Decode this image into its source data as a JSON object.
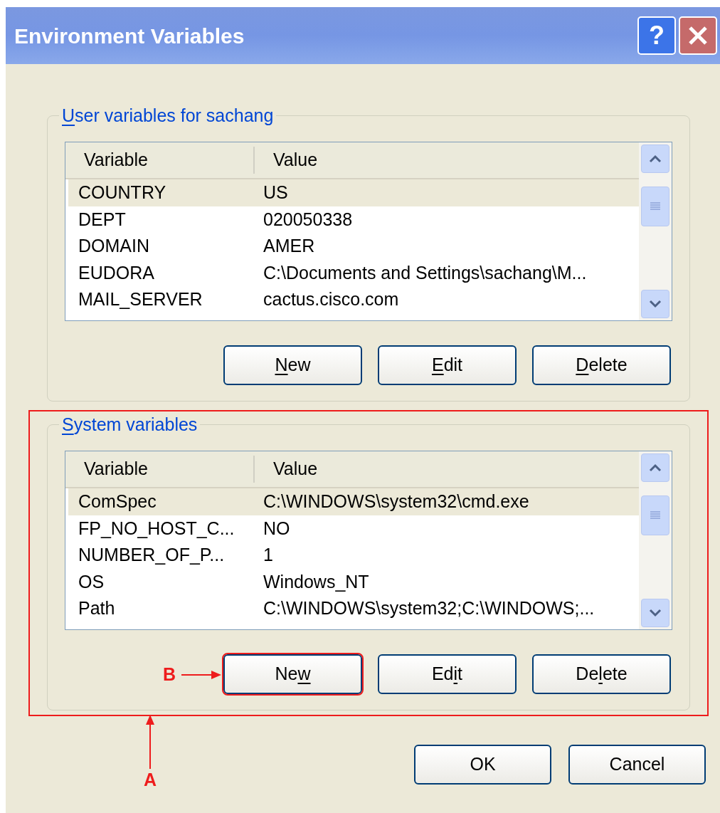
{
  "window": {
    "title": "Environment Variables",
    "controls": [
      {
        "kind": "help",
        "label": "?"
      },
      {
        "kind": "close"
      }
    ]
  },
  "groups": [
    {
      "title": {
        "key": "U",
        "after": "ser variables for sachang"
      },
      "highlighted": false,
      "columns": [
        "Variable",
        "Value"
      ],
      "rows": [
        {
          "variable": "COUNTRY",
          "value": "US",
          "selected": true
        },
        {
          "variable": "DEPT",
          "value": "020050338",
          "selected": false
        },
        {
          "variable": "DOMAIN",
          "value": "AMER",
          "selected": false
        },
        {
          "variable": "EUDORA",
          "value": "C:\\Documents and Settings\\sachang\\M...",
          "selected": false
        },
        {
          "variable": "MAIL_SERVER",
          "value": "cactus.cisco.com",
          "selected": false
        }
      ],
      "buttons": [
        {
          "key": "N",
          "after": "ew",
          "highlighted": false
        },
        {
          "key": "E",
          "after": "dit",
          "highlighted": false
        },
        {
          "key": "D",
          "after": "elete",
          "highlighted": false
        }
      ]
    },
    {
      "title": {
        "key": "S",
        "after": "ystem variables"
      },
      "highlighted": true,
      "annotation": "A",
      "columns": [
        "Variable",
        "Value"
      ],
      "rows": [
        {
          "variable": "ComSpec",
          "value": "C:\\WINDOWS\\system32\\cmd.exe",
          "selected": true
        },
        {
          "variable": "FP_NO_HOST_C...",
          "value": "NO",
          "selected": false
        },
        {
          "variable": "NUMBER_OF_P...",
          "value": "1",
          "selected": false
        },
        {
          "variable": "OS",
          "value": "Windows_NT",
          "selected": false
        },
        {
          "variable": "Path",
          "value": "C:\\WINDOWS\\system32;C:\\WINDOWS;...",
          "selected": false
        }
      ],
      "buttons": [
        {
          "before": "Ne",
          "key": "w",
          "highlighted": true,
          "annotation": "B"
        },
        {
          "before": "Ed",
          "key": "i",
          "after": "t",
          "highlighted": false
        },
        {
          "before": "De",
          "key": "l",
          "after": "ete",
          "highlighted": false
        }
      ]
    }
  ],
  "dialog_buttons": [
    "OK",
    "Cancel"
  ]
}
